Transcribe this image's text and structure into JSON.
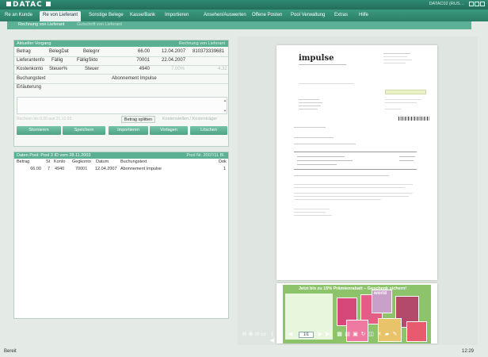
{
  "app": {
    "name": "DATAC",
    "id_text": "DATAC02 (RUS…"
  },
  "menu": [
    "Re an Kunde",
    "Re von Lieferant",
    "Sonstige Belege",
    "Kasse/Bank",
    "Importieren",
    "Ansehen/Auswerten",
    "Offene Posten",
    "Pool Verwaltung",
    "Extras",
    "Hilfe"
  ],
  "subtabs": [
    "Rechnung von Lieferant",
    "Gutschrift von Lieferant"
  ],
  "form": {
    "header": "Aktueller Vorgang",
    "header_right": "Rechnung von Lieferant",
    "labels": {
      "betrag": "Betrag",
      "belegdat": "BelegDat",
      "belegnr": "Belegnr",
      "lieferant": "Lieferantenfo",
      "faellig": "Fällig",
      "faelligskto": "FälligSkto",
      "kostenkonto": "Kostenkonto",
      "steuerpct": "Steuer%",
      "steuer": "Steuer",
      "buchungstext": "Buchungstext",
      "erlaeuterung": "Erläuterung"
    },
    "values": {
      "betrag": "66.00",
      "belegdat": "12.04.2007",
      "belegnr": "810373339681",
      "lieferant": "70001",
      "faellig": "22.04.2007",
      "kostenkonto": "4940",
      "steuerpct": "7.00%",
      "steuer": "4.32",
      "buchungstext": "Abonnement Impulse"
    },
    "hint": "Rechnen bis 0,00 aus 21.12.03",
    "split_button": "Betrag splitten",
    "kst_label": "Kostenstellen / Kostenträger",
    "buttons": [
      "Stornieren",
      "Speichern",
      "Importieren",
      "Vorlagen",
      "Löschen"
    ]
  },
  "list": {
    "header": "Daten Pool: Pool 3 ID vom 28.11.2003",
    "header_right": "Pool Nr. 2007/11 Bl.",
    "columns": [
      "Betrag",
      "St",
      "Konto",
      "Gegkonto",
      "Datum",
      "Buchungstext",
      "Dok"
    ],
    "rows": [
      [
        "66.00",
        "7",
        "4940",
        "70001",
        "12.04.2007",
        "Abonnement Impulse",
        "1"
      ]
    ]
  },
  "viewer": {
    "brand": "impulse",
    "page": "1/1",
    "promo_headline": "Jetzt bis zu 15% Prämienrabatt – Geschenk sichern!",
    "promo_title": "world"
  },
  "status": {
    "left": "Bereit",
    "right": "12:29"
  },
  "colors": {
    "accent": "#2f8a72",
    "panel_header": "#5bb094",
    "button": "#5cab90"
  }
}
